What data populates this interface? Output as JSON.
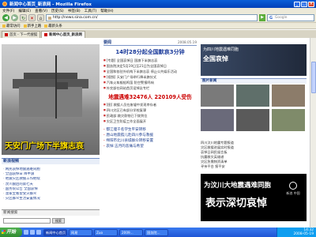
{
  "window": {
    "title": "新闻中心首页_新浪网 - Mozilla Firefox",
    "buttons": [
      "_",
      "□",
      "×"
    ]
  },
  "menubar": [
    "文件(F)",
    "编辑(E)",
    "查看(V)",
    "历史(S)",
    "书签(B)",
    "工具(T)",
    "帮助(H)"
  ],
  "navbar": {
    "back_icon": "◀",
    "forward_icon": "▶",
    "reload_icon": "↻",
    "stop_icon": "✕",
    "home_icon": "⌂",
    "url": "http://news.sina.com.cn/",
    "go_icon": "▶",
    "search_placeholder": "Google"
  },
  "bookmarks": [
    "最常访问",
    "新手上路",
    "最新头条"
  ],
  "tabs": [
    {
      "label": "首页 - 下一代搜狐"
    },
    {
      "label": "新闻中心首页_新浪网"
    }
  ],
  "page": {
    "left": {
      "photo_caption": "天安门广场下半旗志哀",
      "news_section": "新浪视频",
      "news_items": [
        "网民哀悼地震遇难同胞",
        "全国哀悼日 降半旗",
        "地震灾区救援工作继续",
        "汶川震后的第七天",
        "国务院公告 全国哀悼",
        "温家宝看望受灾群众",
        "灾区群众生活安置情况"
      ],
      "search_section": "新闻搜索",
      "search_button": "搜索"
    },
    "middle": {
      "section": "要闻",
      "date": "2008.05.19",
      "headline1": "14时28分起全国默哀3分钟",
      "body_lines": [
        "[专题] 全国哀悼日 国旗下半旗志哀",
        "国务院决定5月19日至21日为全国哀悼日",
        "全国和各驻外机构下半旗志哀 停止公共娱乐活动",
        "[视频] 天安门广场举行降半旗仪式",
        "汽车火车舰船鸣笛 防空警报鸣响",
        "外交部在网站首页设悼念专栏"
      ],
      "headline2": "地震遇难32476人 220109人受伤",
      "body_lines2": [
        "[图] 救援人员在废墟中发现幸存者",
        "四川灾区已有部分学校复课",
        "民政部:救灾款物已下拨到位",
        "灾区卫生防疫工作全面展开"
      ],
      "bottom_links": [
        "都江堰千名学生平安转移",
        "唐山地震孤儿赴四川参与救援",
        "绵阳市北川县城群众转移安置",
        "哀悼:五月的悲痛与希望"
      ]
    },
    "right": {
      "ad1_small": "为四川地震遇难同胞",
      "ad1_big": "全国哀悼",
      "photo_section": "图片新闻",
      "list_items": [
        "四川汶川地震专题报道",
        "灾区救援进展实时报道",
        "哀悼日网民留言板",
        "抗震救灾英雄谱",
        "灾区急需物资清单",
        "寻亲平台 报平安"
      ],
      "ad2_line1": "为汶川大地震遇难同胞",
      "ad2_line2": "表示深切哀悼",
      "ad2_logo": "新浪 中国"
    }
  },
  "taskbar": {
    "start": "开始",
    "tasks": [
      "新闻中心首页",
      "网易",
      "Zuo",
      "2009...",
      "国务院..."
    ],
    "clock": "14:32",
    "date": "2008-05-19"
  }
}
